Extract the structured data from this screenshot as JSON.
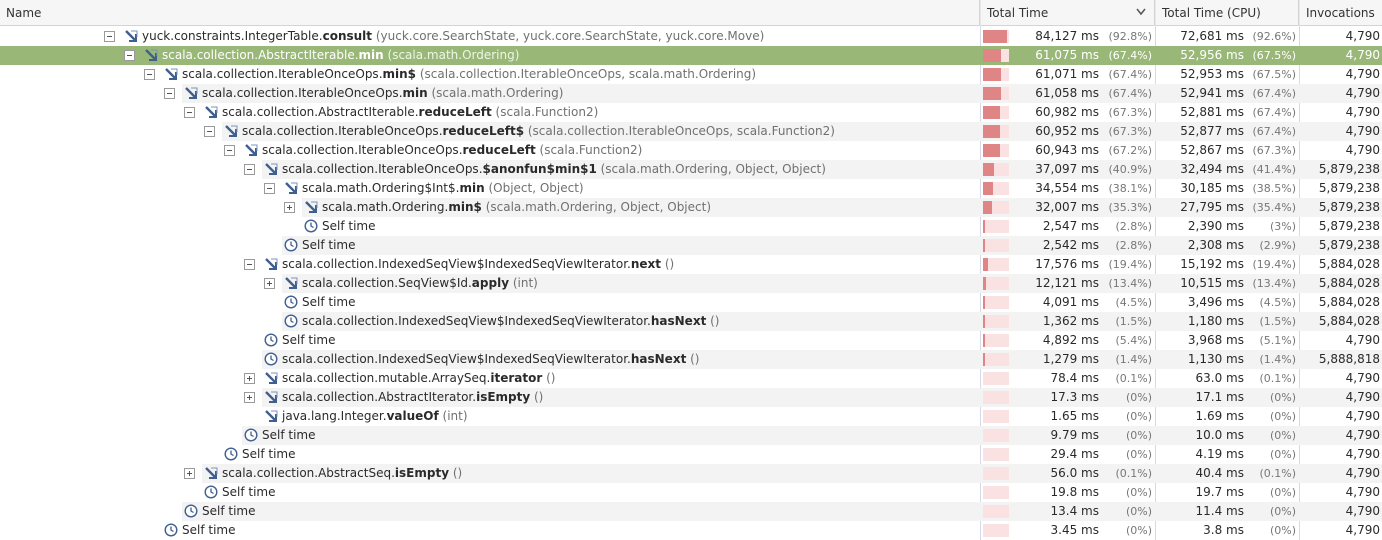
{
  "columns": {
    "name": "Name",
    "total_time": "Total Time",
    "total_time_cpu": "Total Time (CPU)",
    "invocations": "Invocations"
  },
  "icons": {
    "method": "method-call-icon",
    "self": "clock-icon",
    "sort": "chevron-down-icon"
  },
  "colors": {
    "selected_row": "#99b878",
    "bar_fill": "#df8585",
    "bar_bg": "#fbe2e2"
  },
  "rows": [
    {
      "depth": 0,
      "toggle": "minus",
      "icon": "method",
      "pkg": "yuck.constraints.IntegerTable.",
      "method": "consult",
      "sig": " (yuck.core.SearchState, yuck.core.SearchState, yuck.core.Move)",
      "total": "84,127 ms",
      "total_pct": "(92.8%)",
      "cpu": "72,681 ms",
      "cpu_pct": "(92.6%)",
      "inv": "4,790",
      "bar": 0.928
    },
    {
      "depth": 1,
      "toggle": "minus",
      "icon": "method",
      "pkg": "scala.collection.AbstractIterable.",
      "method": "min",
      "sig": " (scala.math.Ordering)",
      "total": "61,075 ms",
      "total_pct": "(67.4%)",
      "cpu": "52,956 ms",
      "cpu_pct": "(67.5%)",
      "inv": "4,790",
      "bar": 0.674,
      "selected": true
    },
    {
      "depth": 2,
      "toggle": "minus",
      "icon": "method",
      "pkg": "scala.collection.IterableOnceOps.",
      "method": "min$",
      "sig": " (scala.collection.IterableOnceOps, scala.math.Ordering)",
      "total": "61,071 ms",
      "total_pct": "(67.4%)",
      "cpu": "52,953 ms",
      "cpu_pct": "(67.5%)",
      "inv": "4,790",
      "bar": 0.674
    },
    {
      "depth": 3,
      "toggle": "minus",
      "icon": "method",
      "pkg": "scala.collection.IterableOnceOps.",
      "method": "min",
      "sig": " (scala.math.Ordering)",
      "total": "61,058 ms",
      "total_pct": "(67.4%)",
      "cpu": "52,941 ms",
      "cpu_pct": "(67.4%)",
      "inv": "4,790",
      "bar": 0.674
    },
    {
      "depth": 4,
      "toggle": "minus",
      "icon": "method",
      "pkg": "scala.collection.AbstractIterable.",
      "method": "reduceLeft",
      "sig": " (scala.Function2)",
      "total": "60,982 ms",
      "total_pct": "(67.3%)",
      "cpu": "52,881 ms",
      "cpu_pct": "(67.4%)",
      "inv": "4,790",
      "bar": 0.673
    },
    {
      "depth": 5,
      "toggle": "minus",
      "icon": "method",
      "pkg": "scala.collection.IterableOnceOps.",
      "method": "reduceLeft$",
      "sig": " (scala.collection.IterableOnceOps, scala.Function2)",
      "total": "60,952 ms",
      "total_pct": "(67.3%)",
      "cpu": "52,877 ms",
      "cpu_pct": "(67.4%)",
      "inv": "4,790",
      "bar": 0.673
    },
    {
      "depth": 6,
      "toggle": "minus",
      "icon": "method",
      "pkg": "scala.collection.IterableOnceOps.",
      "method": "reduceLeft",
      "sig": " (scala.Function2)",
      "total": "60,943 ms",
      "total_pct": "(67.2%)",
      "cpu": "52,867 ms",
      "cpu_pct": "(67.3%)",
      "inv": "4,790",
      "bar": 0.672
    },
    {
      "depth": 7,
      "toggle": "minus",
      "icon": "method",
      "pkg": "scala.collection.IterableOnceOps.",
      "method": "$anonfun$min$1",
      "sig": " (scala.math.Ordering, Object, Object)",
      "total": "37,097 ms",
      "total_pct": "(40.9%)",
      "cpu": "32,494 ms",
      "cpu_pct": "(41.4%)",
      "inv": "5,879,238",
      "bar": 0.409
    },
    {
      "depth": 8,
      "toggle": "minus",
      "icon": "method",
      "pkg": "scala.math.Ordering$Int$.",
      "method": "min",
      "sig": " (Object, Object)",
      "total": "34,554 ms",
      "total_pct": "(38.1%)",
      "cpu": "30,185 ms",
      "cpu_pct": "(38.5%)",
      "inv": "5,879,238",
      "bar": 0.381
    },
    {
      "depth": 9,
      "toggle": "plus",
      "icon": "method",
      "pkg": "scala.math.Ordering.",
      "method": "min$",
      "sig": " (scala.math.Ordering, Object, Object)",
      "total": "32,007 ms",
      "total_pct": "(35.3%)",
      "cpu": "27,795 ms",
      "cpu_pct": "(35.4%)",
      "inv": "5,879,238",
      "bar": 0.353
    },
    {
      "depth": 9,
      "toggle": "none",
      "icon": "self",
      "pkg": "Self time",
      "method": "",
      "sig": "",
      "total": "2,547 ms",
      "total_pct": "(2.8%)",
      "cpu": "2,390 ms",
      "cpu_pct": "(3%)",
      "inv": "5,879,238",
      "bar": 0.028
    },
    {
      "depth": 8,
      "toggle": "none",
      "icon": "self",
      "pkg": "Self time",
      "method": "",
      "sig": "",
      "total": "2,542 ms",
      "total_pct": "(2.8%)",
      "cpu": "2,308 ms",
      "cpu_pct": "(2.9%)",
      "inv": "5,879,238",
      "bar": 0.028
    },
    {
      "depth": 7,
      "toggle": "minus",
      "icon": "method",
      "pkg": "scala.collection.IndexedSeqView$IndexedSeqViewIterator.",
      "method": "next",
      "sig": " ()",
      "total": "17,576 ms",
      "total_pct": "(19.4%)",
      "cpu": "15,192 ms",
      "cpu_pct": "(19.4%)",
      "inv": "5,884,028",
      "bar": 0.194
    },
    {
      "depth": 8,
      "toggle": "plus",
      "icon": "method",
      "pkg": "scala.collection.SeqView$Id.",
      "method": "apply",
      "sig": " (int)",
      "total": "12,121 ms",
      "total_pct": "(13.4%)",
      "cpu": "10,515 ms",
      "cpu_pct": "(13.4%)",
      "inv": "5,884,028",
      "bar": 0.134
    },
    {
      "depth": 8,
      "toggle": "none",
      "icon": "self",
      "pkg": "Self time",
      "method": "",
      "sig": "",
      "total": "4,091 ms",
      "total_pct": "(4.5%)",
      "cpu": "3,496 ms",
      "cpu_pct": "(4.5%)",
      "inv": "5,884,028",
      "bar": 0.045
    },
    {
      "depth": 8,
      "toggle": "none",
      "icon": "self",
      "pkg": "scala.collection.IndexedSeqView$IndexedSeqViewIterator.",
      "method": "hasNext",
      "sig": " ()",
      "total": "1,362 ms",
      "total_pct": "(1.5%)",
      "cpu": "1,180 ms",
      "cpu_pct": "(1.5%)",
      "inv": "5,884,028",
      "bar": 0.015
    },
    {
      "depth": 7,
      "toggle": "none",
      "icon": "self",
      "pkg": "Self time",
      "method": "",
      "sig": "",
      "total": "4,892 ms",
      "total_pct": "(5.4%)",
      "cpu": "3,968 ms",
      "cpu_pct": "(5.1%)",
      "inv": "4,790",
      "bar": 0.054
    },
    {
      "depth": 7,
      "toggle": "none",
      "icon": "self",
      "pkg": "scala.collection.IndexedSeqView$IndexedSeqViewIterator.",
      "method": "hasNext",
      "sig": " ()",
      "total": "1,279 ms",
      "total_pct": "(1.4%)",
      "cpu": "1,130 ms",
      "cpu_pct": "(1.4%)",
      "inv": "5,888,818",
      "bar": 0.014
    },
    {
      "depth": 7,
      "toggle": "plus",
      "icon": "method",
      "pkg": "scala.collection.mutable.ArraySeq.",
      "method": "iterator",
      "sig": " ()",
      "total": "78.4 ms",
      "total_pct": "(0.1%)",
      "cpu": "63.0 ms",
      "cpu_pct": "(0.1%)",
      "inv": "4,790",
      "bar": 0.001
    },
    {
      "depth": 7,
      "toggle": "plus",
      "icon": "method",
      "pkg": "scala.collection.AbstractIterator.",
      "method": "isEmpty",
      "sig": " ()",
      "total": "17.3 ms",
      "total_pct": "(0%)",
      "cpu": "17.1 ms",
      "cpu_pct": "(0%)",
      "inv": "4,790",
      "bar": 0
    },
    {
      "depth": 7,
      "toggle": "none",
      "icon": "method",
      "pkg": "java.lang.Integer.",
      "method": "valueOf",
      "sig": " (int)",
      "total": "1.65 ms",
      "total_pct": "(0%)",
      "cpu": "1.69 ms",
      "cpu_pct": "(0%)",
      "inv": "4,790",
      "bar": 0
    },
    {
      "depth": 6,
      "toggle": "none",
      "icon": "self",
      "pkg": "Self time",
      "method": "",
      "sig": "",
      "total": "9.79 ms",
      "total_pct": "(0%)",
      "cpu": "10.0 ms",
      "cpu_pct": "(0%)",
      "inv": "4,790",
      "bar": 0
    },
    {
      "depth": 5,
      "toggle": "none",
      "icon": "self",
      "pkg": "Self time",
      "method": "",
      "sig": "",
      "total": "29.4 ms",
      "total_pct": "(0%)",
      "cpu": "4.19 ms",
      "cpu_pct": "(0%)",
      "inv": "4,790",
      "bar": 0
    },
    {
      "depth": 4,
      "toggle": "plus",
      "icon": "method",
      "pkg": "scala.collection.AbstractSeq.",
      "method": "isEmpty",
      "sig": " ()",
      "total": "56.0 ms",
      "total_pct": "(0.1%)",
      "cpu": "40.4 ms",
      "cpu_pct": "(0.1%)",
      "inv": "4,790",
      "bar": 0.001
    },
    {
      "depth": 4,
      "toggle": "none",
      "icon": "self",
      "pkg": "Self time",
      "method": "",
      "sig": "",
      "total": "19.8 ms",
      "total_pct": "(0%)",
      "cpu": "19.7 ms",
      "cpu_pct": "(0%)",
      "inv": "4,790",
      "bar": 0
    },
    {
      "depth": 3,
      "toggle": "none",
      "icon": "self",
      "pkg": "Self time",
      "method": "",
      "sig": "",
      "total": "13.4 ms",
      "total_pct": "(0%)",
      "cpu": "11.4 ms",
      "cpu_pct": "(0%)",
      "inv": "4,790",
      "bar": 0
    },
    {
      "depth": 2,
      "toggle": "none",
      "icon": "self",
      "pkg": "Self time",
      "method": "",
      "sig": "",
      "total": "3.45 ms",
      "total_pct": "(0%)",
      "cpu": "3.8 ms",
      "cpu_pct": "(0%)",
      "inv": "4,790",
      "bar": 0
    }
  ]
}
